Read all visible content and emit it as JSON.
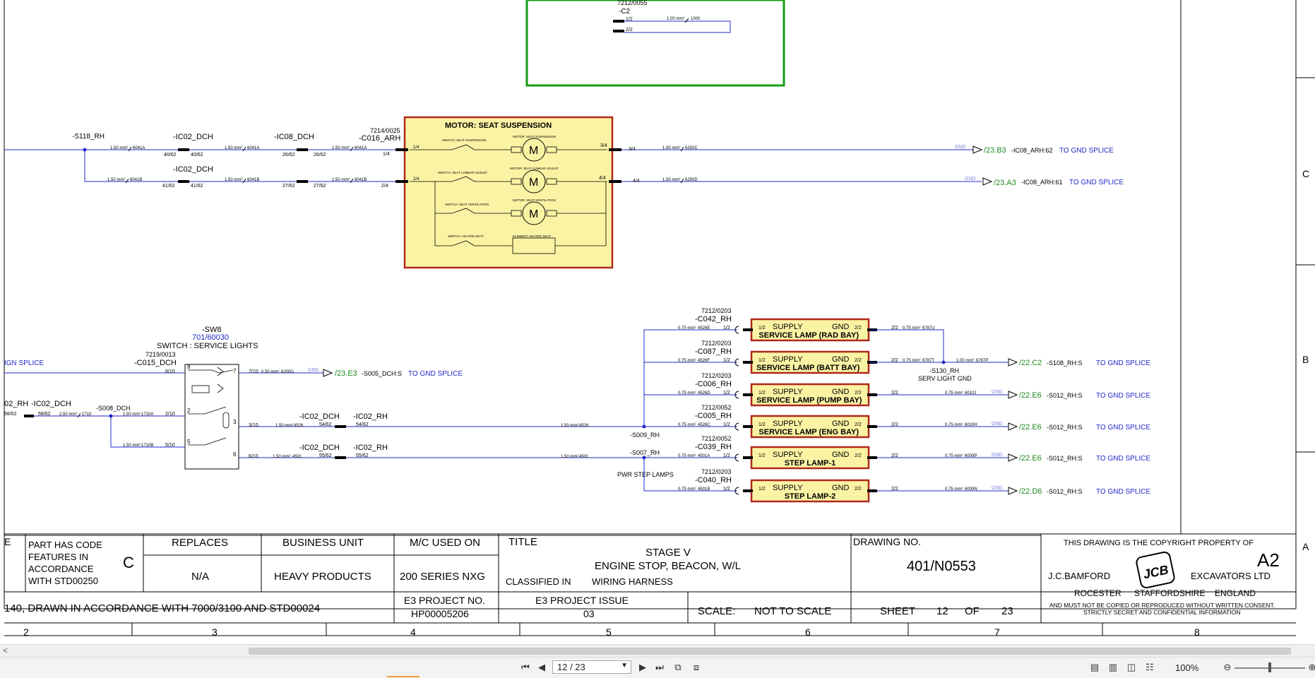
{
  "drawing": {
    "top_box": {
      "ref": "7212/0055",
      "conn": "-C2",
      "pin1": "1/2",
      "pin2": "2/2",
      "wire": "1.00 mm²",
      "wire_id": "1000"
    },
    "seat": {
      "title": "MOTOR: SEAT SUSPENSION",
      "conn_ref": "7214/0025",
      "conn": "-C016_ARH",
      "pin_a": "1/4",
      "pin_b": "2/4",
      "pin_c": "3/4",
      "pin_d": "4/4",
      "sw1": "SWITCH: SEAT SUSPENSION",
      "m1": "MOTOR: SEAT SUSPENSION",
      "sw2": "SWITCH: SEAT LUMBAR ADJUST",
      "m2": "MOTOR: SEAT LUMBAR ADJUST",
      "sw3": "SWITCH: SEAT VENTILATION",
      "m3": "MOTOR: SEAT VENTILATION",
      "sw4": "SWITCH: HEATED SEAT",
      "m4": "ELEMENT: HEATED SEAT",
      "motor_glyph": "M"
    },
    "row1": {
      "splice": "-S118_RH",
      "c1": "-IC02_DCH",
      "c1p1": "40/62",
      "c1p2": "40/62",
      "c2": "-IC08_DCH",
      "c2p1": "26/62",
      "c2p2": "26/62",
      "w1": "1.50 mm²",
      "w1id": "6041A",
      "w2id": "6041A",
      "w3id": "6041A",
      "pin_in": "1/4",
      "pin_out": "3/4",
      "wout": "1.50 mm²",
      "woutid": "6250C",
      "gnd": "GND",
      "ref": "/23.B3",
      "dest": "-IC08_ARH:62",
      "note": "TO GND SPLICE"
    },
    "row2": {
      "c1": "-IC02_DCH",
      "c1p1": "41/62",
      "c1p2": "41/62",
      "c2p1": "27/62",
      "c2p2": "27/62",
      "w1": "1.50 mm²",
      "w1id": "6041B",
      "w2id": "6041B",
      "w3id": "6041B",
      "pin_in": "2/4",
      "pin_out": "4/4",
      "wout": "1.50 mm²",
      "woutid": "6250D",
      "gnd": "GND",
      "ref": "/23.A3",
      "dest": "-IC08_ARH:61",
      "note": "TO GND SPLICE"
    },
    "sw8": {
      "name": "-SW8",
      "part": "701/60030",
      "desc": "SWITCH : SERVICE LIGHTS",
      "conn_ref": "7219/0013",
      "conn": "-C015_DCH",
      "p8": "8/10",
      "p7": "7/10",
      "p2": "2/10",
      "p3": "3/10",
      "p5": "5/10",
      "p6": "6/10",
      "n8": "8",
      "n7": "7",
      "n2": "2",
      "n3": "3",
      "n5": "5",
      "n6": "6"
    },
    "left": {
      "ign": "IGN SPLICE",
      "rh": "02_RH",
      "ic": "-IC02_DCH",
      "ic_p": "58/62",
      "ic_p2": "58/62",
      "w": "2.50 mm²",
      "wid": "1710",
      "splice": "-S008_DCH",
      "w_a": "1.50 mm²",
      "w_aid": "1710A",
      "w_b": "1.50 mm²",
      "w_bid": "1710B",
      "out_w": "0.50 mm²",
      "out_wid": "6200G",
      "out_gnd": "GND",
      "out_ref": "/23.E3",
      "out_dest": "-S005_DCH:S",
      "out_note": "TO GND SPLICE"
    },
    "mid": {
      "c_a": "-IC02_DCH",
      "c_a_p": "54/62",
      "c_b": "-IC02_RH",
      "c_b_p": "54/62",
      "wa": "1.50 mm²",
      "waid": "4526",
      "c_c": "-IC02_DCH",
      "c_c_p": "55/62",
      "c_d": "-IC02_RH",
      "c_d_p": "55/62",
      "wb": "1.50 mm²",
      "wbid": "4501",
      "wa2": "1.50 mm²",
      "wa2id": "4526",
      "wb2": "1.50 mm²",
      "wb2id": "4501",
      "s009": "-S009_RH",
      "s007": "-S007_RH",
      "pwr": "PWR STEP LAMPS"
    },
    "lamps": [
      {
        "ref": "7212/0203",
        "conn": "-C042_RH",
        "title": "SERVICE LAMP (RAD BAY)",
        "w_in": "0.75 mm²",
        "wid_in": "4526E",
        "p1": "1/2",
        "p2": "2/2",
        "w_out": "0.75 mm²",
        "wid_out": "6787U",
        "gnd": "",
        "dest_ref": "",
        "dest": "",
        "note": ""
      },
      {
        "ref": "7212/0203",
        "conn": "-C087_RH",
        "title": "SERVICE LAMP (BATT BAY)",
        "w_in": "0.75 mm²",
        "wid_in": "4526F",
        "p1": "1/2",
        "p2": "2/2",
        "w_out": "0.75 mm²",
        "wid_out": "6787T",
        "gnd": "",
        "dest_ref": "/22.C2",
        "dest": "-S108_RH:S",
        "note": "TO GND SPLICE"
      },
      {
        "ref": "7212/0203",
        "conn": "-C006_RH",
        "title": "SERVICE LAMP (PUMP BAY)",
        "w_in": "0.75 mm²",
        "wid_in": "4526D",
        "p1": "1/2",
        "p2": "2/2",
        "w_out": "0.75 mm²",
        "wid_out": "6010J",
        "gnd": "GND",
        "dest_ref": "/22.E6",
        "dest": "-S012_RH:S",
        "note": "TO GND SPLICE"
      },
      {
        "ref": "7212/0052",
        "conn": "-C005_RH",
        "title": "SERVICE LAMP (ENG BAY)",
        "w_in": "0.75 mm²",
        "wid_in": "4526C",
        "p1": "1/2",
        "p2": "2/2",
        "w_out": "0.75 mm²",
        "wid_out": "6010H",
        "gnd": "GND",
        "dest_ref": "/22.E6",
        "dest": "-S012_RH:S",
        "note": "TO GND SPLICE"
      },
      {
        "ref": "7212/0052",
        "conn": "-C039_RH",
        "title": "STEP LAMP-1",
        "w_in": "0.75 mm²",
        "wid_in": "4501A",
        "p1": "1/2",
        "p2": "2/2",
        "w_out": "0.75 mm²",
        "wid_out": "6009P",
        "gnd": "GND",
        "dest_ref": "/22.E6",
        "dest": "-S012_RH:S",
        "note": "TO GND SPLICE"
      },
      {
        "ref": "7212/0203",
        "conn": "-C040_RH",
        "title": "STEP LAMP-2",
        "w_in": "0.75 mm²",
        "wid_in": "4501B",
        "p1": "1/2",
        "p2": "2/2",
        "w_out": "0.75 mm²",
        "wid_out": "6009N",
        "gnd": "GND",
        "dest_ref": "/22.D6",
        "dest": "-S012_RH:S",
        "note": "TO GND SPLICE"
      }
    ],
    "lamp_common": {
      "supply": "SUPPLY",
      "gnd": "GND"
    },
    "s130": {
      "name": "-S130_RH",
      "desc": "SERV LIGHT GND",
      "w": "1.00 mm²",
      "wid": "6787P"
    },
    "zones": {
      "right": [
        "C",
        "B",
        "A"
      ],
      "bottom": [
        "2",
        "3",
        "4",
        "5",
        "6",
        "7",
        "8"
      ]
    }
  },
  "title_block": {
    "edge_label": "E",
    "code_text": [
      "PART HAS CODE",
      "FEATURES IN",
      "ACCORDANCE",
      "WITH STD00250"
    ],
    "code_letter": "C",
    "replaces_h": "REPLACES",
    "replaces_v": "N/A",
    "bu_h": "BUSINESS UNIT",
    "bu_v": "HEAVY PRODUCTS",
    "mc_h": "M/C USED ON",
    "mc_v": "200 SERIES NXG",
    "title_h": "TITLE",
    "title_1": "STAGE V",
    "title_2": "ENGINE STOP, BEACON, W/L",
    "classified_h": "CLASSIFIED IN",
    "classified_v": "WIRING HARNESS",
    "drawn_note": "140, DRAWN IN ACCORDANCE WITH 7000/3100 AND STD00024",
    "e3_no_h": "E3 PROJECT NO.",
    "e3_no_v": "HP00005206",
    "e3_issue_h": "E3 PROJECT ISSUE",
    "e3_issue_v": "03",
    "scale_h": "SCALE:",
    "scale_v": "NOT TO SCALE",
    "dwg_h": "DRAWING NO.",
    "dwg_v": "401/N0553",
    "sheet_h": "SHEET",
    "sheet_v": "12",
    "of_h": "OF",
    "of_v": "23",
    "copyright": "THIS DRAWING IS THE COPYRIGHT PROPERTY OF",
    "size": "A2",
    "co_left": "J.C.BAMFORD",
    "co_right": "EXCAVATORS LTD",
    "logo": "JCB",
    "addr1": "ROCESTER",
    "addr2": "STAFFORDSHIRE",
    "addr3": "ENGLAND",
    "legal1": "AND MUST NOT BE COPIED OR REPRODUCED WITHOUT WRITTEN CONSENT.",
    "legal2": "STRICTLY SECRET AND CONFIDENTIAL INFORMATION"
  },
  "viewer": {
    "page": "12 / 23",
    "zoom": "100%",
    "scroll_left": "<"
  },
  "colors": {
    "wire": "#1f28c8",
    "box_fill": "#fbf3a4",
    "box_border": "#b0281a",
    "green": "#1f8a1f"
  }
}
